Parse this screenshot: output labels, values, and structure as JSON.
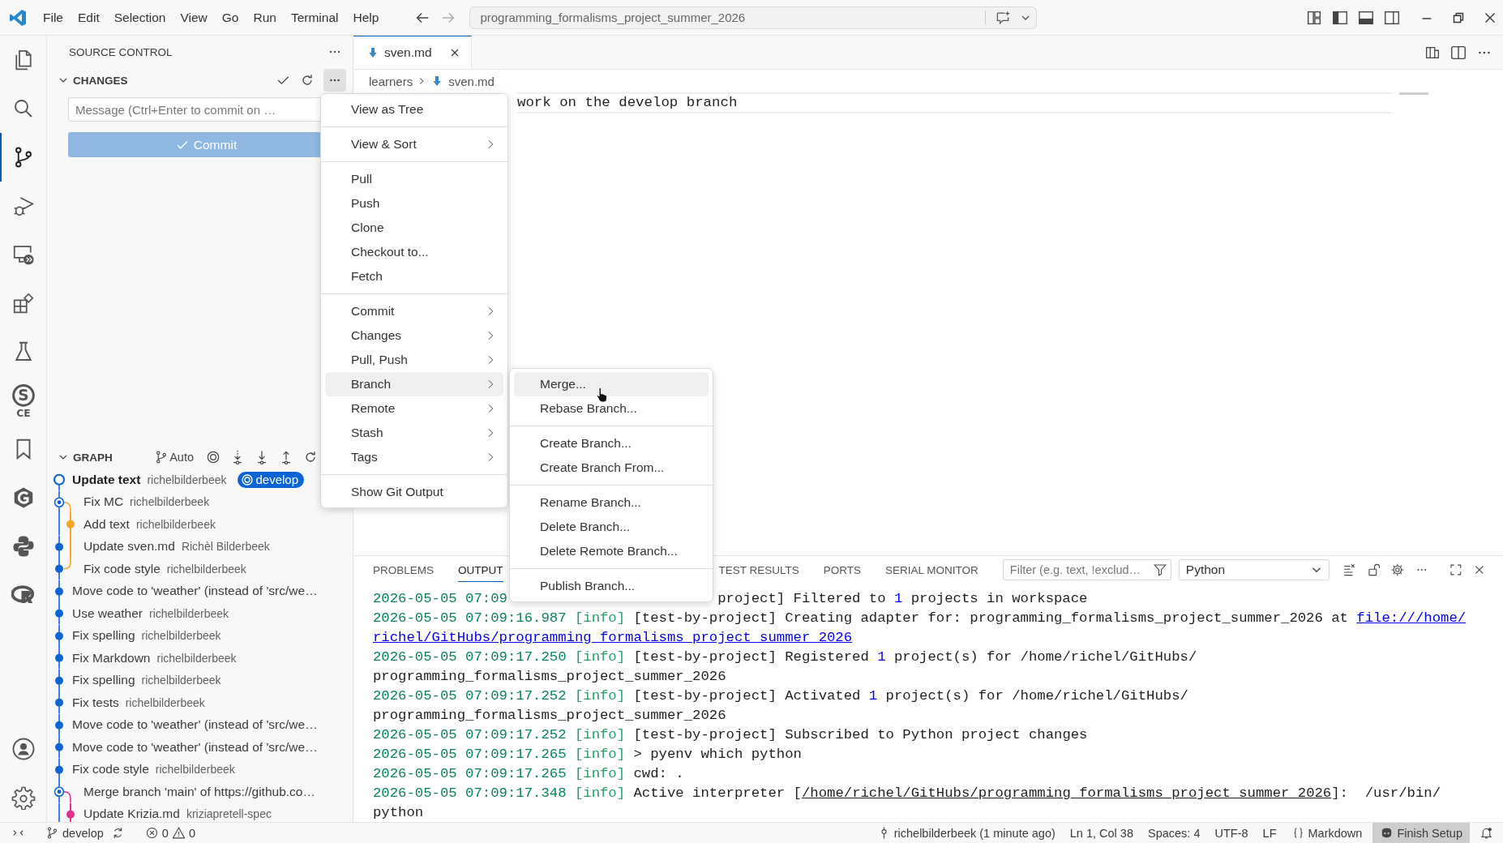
{
  "title_bar": {
    "menu": [
      "File",
      "Edit",
      "Selection",
      "View",
      "Go",
      "Run",
      "Terminal",
      "Help"
    ],
    "command_center": "programming_formalisms_project_summer_2026"
  },
  "activity_bar": [
    {
      "kind": "files",
      "selected": false
    },
    {
      "kind": "search",
      "selected": false
    },
    {
      "kind": "source-control",
      "selected": true
    },
    {
      "kind": "run-debug",
      "selected": false
    },
    {
      "kind": "remote",
      "selected": false
    },
    {
      "kind": "extensions",
      "selected": false
    },
    {
      "kind": "testing",
      "selected": false
    },
    {
      "kind": "letters",
      "letters": [
        "S",
        "CE"
      ],
      "selected": false
    },
    {
      "kind": "bookmark",
      "selected": false
    },
    {
      "kind": "hexagon",
      "selected": false
    },
    {
      "kind": "snakes",
      "selected": false
    },
    {
      "kind": "ring",
      "selected": false
    }
  ],
  "activity_bar_bottom": [
    {
      "kind": "account"
    },
    {
      "kind": "settings"
    }
  ],
  "sidebar": {
    "title": "SOURCE CONTROL",
    "changes": {
      "title": "CHANGES",
      "message": {
        "placeholder": "Message (Ctrl+Enter to commit on …"
      },
      "commit_button": {
        "label": "Commit",
        "disabled": true
      }
    },
    "graph": {
      "title": "GRAPH",
      "mode": "Auto",
      "commits": [
        {
          "message": "Update text",
          "author": "richelbilderbeek",
          "kind": "head",
          "color": "#0a64d6",
          "ref": "develop"
        },
        {
          "message": "Fix MC",
          "author": "richelbilderbeek",
          "kind": "merge",
          "color": "#0a64d6",
          "side_lane": {
            "kind": "start",
            "color": "#f5a623"
          }
        },
        {
          "message": "Add text",
          "author": "richelbilderbeek",
          "kind": "side",
          "color": "#f5a623",
          "side_lane": {
            "kind": "node",
            "color": "#f5a623"
          }
        },
        {
          "message": "Update sven.md",
          "author": "Richèl Bilderbeek",
          "kind": "commit",
          "color": "#0a64d6",
          "side_lane": {
            "kind": "through",
            "color": "#f5a623"
          }
        },
        {
          "message": "Fix code style",
          "author": "richelbilderbeek",
          "kind": "commit",
          "color": "#0a64d6",
          "side_lane": {
            "kind": "end",
            "color": "#f5a623"
          }
        },
        {
          "message": "Move code to 'weather' (instead of 'src/we…",
          "kind": "commit",
          "color": "#0a64d6"
        },
        {
          "message": "Use weather",
          "author": "richelbilderbeek",
          "kind": "commit",
          "color": "#0a64d6"
        },
        {
          "message": "Fix spelling",
          "author": "richelbilderbeek",
          "kind": "commit",
          "color": "#0a64d6"
        },
        {
          "message": "Fix Markdown",
          "author": "richelbilderbeek",
          "kind": "commit",
          "color": "#0a64d6"
        },
        {
          "message": "Fix spelling",
          "author": "richelbilderbeek",
          "kind": "commit",
          "color": "#0a64d6"
        },
        {
          "message": "Fix tests",
          "author": "richelbilderbeek",
          "kind": "commit",
          "color": "#0a64d6"
        },
        {
          "message": "Move code to 'weather' (instead of 'src/we…",
          "kind": "commit",
          "color": "#0a64d6"
        },
        {
          "message": "Move code to 'weather' (instead of 'src/we…",
          "kind": "commit",
          "color": "#0a64d6"
        },
        {
          "message": "Fix code style",
          "author": "richelbilderbeek",
          "kind": "commit",
          "color": "#0a64d6"
        },
        {
          "message": "Merge branch 'main' of https://github.co…",
          "kind": "merge",
          "color": "#0a64d6",
          "side_lane": {
            "kind": "start",
            "color": "#e0338a"
          }
        },
        {
          "message": "Update Krizia.md",
          "author": "kriziapretell-spec",
          "kind": "side",
          "color": "#e0338a",
          "side_lane": {
            "kind": "node",
            "color": "#e0338a"
          }
        }
      ]
    }
  },
  "editor": {
    "tabs": [
      {
        "label": "sven.md",
        "selected": true
      }
    ],
    "breadcrumb": [
      "learners",
      "sven.md"
    ],
    "lines": [
      "work on the develop branch"
    ]
  },
  "panel": {
    "tabs": [
      {
        "label": "PROBLEMS",
        "selected": false
      },
      {
        "label": "OUTPUT",
        "selected": true
      }
    ],
    "tabs_after_menu": [
      {
        "label": "TEST RESULTS",
        "selected": false
      },
      {
        "label": "PORTS",
        "selected": false
      },
      {
        "label": "SERIAL MONITOR",
        "selected": false
      }
    ],
    "filter": {
      "placeholder": "Filter (e.g. text, !exclud…"
    },
    "channel": "Python",
    "output": [
      {
        "segments": [
          {
            "kind": "time",
            "text": "2026-05-05 07:09"
          }
        ],
        "after_menu": [
          {
            "kind": "text",
            "text": "project] Filtered to "
          },
          {
            "kind": "number",
            "text": "1"
          },
          {
            "kind": "text",
            "text": " projects in workspace"
          }
        ]
      },
      {
        "segments": [
          {
            "kind": "time",
            "text": "2026-05-05 07:09:16.987"
          },
          {
            "kind": "level",
            "text": "[info]"
          },
          {
            "kind": "text",
            "text": "[test-by-project] Creating adapter for: programming_formalisms_project_summer_2026 at "
          },
          {
            "kind": "link",
            "text": "file:///home/"
          }
        ]
      },
      {
        "segments": [
          {
            "kind": "link",
            "text": "richel/GitHubs/programming_formalisms_project_summer_2026"
          }
        ]
      },
      {
        "segments": [
          {
            "kind": "time",
            "text": "2026-05-05 07:09:17.250"
          },
          {
            "kind": "level",
            "text": "[info]"
          },
          {
            "kind": "text",
            "text": "[test-by-project] Registered "
          },
          {
            "kind": "number",
            "text": "1"
          },
          {
            "kind": "text",
            "text": " project(s) for /home/richel/GitHubs/"
          }
        ]
      },
      {
        "segments": [
          {
            "kind": "text",
            "text": "programming_formalisms_project_summer_2026"
          }
        ]
      },
      {
        "segments": [
          {
            "kind": "time",
            "text": "2026-05-05 07:09:17.252"
          },
          {
            "kind": "level",
            "text": "[info]"
          },
          {
            "kind": "text",
            "text": "[test-by-project] Activated "
          },
          {
            "kind": "number",
            "text": "1"
          },
          {
            "kind": "text",
            "text": " project(s) for /home/richel/GitHubs/"
          }
        ]
      },
      {
        "segments": [
          {
            "kind": "text",
            "text": "programming_formalisms_project_summer_2026"
          }
        ]
      },
      {
        "segments": [
          {
            "kind": "time",
            "text": "2026-05-05 07:09:17.252"
          },
          {
            "kind": "level",
            "text": "[info]"
          },
          {
            "kind": "text",
            "text": "[test-by-project] Subscribed to Python project changes"
          }
        ]
      },
      {
        "segments": [
          {
            "kind": "time",
            "text": "2026-05-05 07:09:17.265"
          },
          {
            "kind": "level",
            "text": "[info]"
          },
          {
            "kind": "text",
            "text": "> pyenv which python"
          }
        ]
      },
      {
        "segments": [
          {
            "kind": "time",
            "text": "2026-05-05 07:09:17.265"
          },
          {
            "kind": "level",
            "text": "[info]"
          },
          {
            "kind": "text",
            "text": "cwd: ."
          }
        ]
      },
      {
        "segments": [
          {
            "kind": "time",
            "text": "2026-05-05 07:09:17.348"
          },
          {
            "kind": "level",
            "text": "[info]"
          },
          {
            "kind": "text",
            "text": "Active interpreter ["
          },
          {
            "kind": "path",
            "text": "/home/richel/GitHubs/programming_formalisms_project_summer_2026"
          },
          {
            "kind": "text",
            "text": "]:  /usr/bin/"
          }
        ]
      },
      {
        "segments": [
          {
            "kind": "text",
            "text": "python"
          }
        ]
      }
    ]
  },
  "menu": {
    "groups": [
      [
        {
          "label": "View as Tree",
          "submenu": false,
          "selected": false
        }
      ],
      [
        {
          "label": "View & Sort",
          "submenu": true,
          "selected": false
        }
      ],
      [
        {
          "label": "Pull",
          "submenu": false,
          "selected": false
        },
        {
          "label": "Push",
          "submenu": false,
          "selected": false
        },
        {
          "label": "Clone",
          "submenu": false,
          "selected": false
        },
        {
          "label": "Checkout to...",
          "submenu": false,
          "selected": false
        },
        {
          "label": "Fetch",
          "submenu": false,
          "selected": false
        }
      ],
      [
        {
          "label": "Commit",
          "submenu": true,
          "selected": false
        },
        {
          "label": "Changes",
          "submenu": true,
          "selected": false
        },
        {
          "label": "Pull, Push",
          "submenu": true,
          "selected": false
        },
        {
          "label": "Branch",
          "submenu": true,
          "selected": true
        },
        {
          "label": "Remote",
          "submenu": true,
          "selected": false
        },
        {
          "label": "Stash",
          "submenu": true,
          "selected": false
        },
        {
          "label": "Tags",
          "submenu": true,
          "selected": false
        }
      ],
      [
        {
          "label": "Show Git Output",
          "submenu": false,
          "selected": false
        }
      ]
    ]
  },
  "submenu": {
    "groups": [
      [
        {
          "label": "Merge...",
          "selected": true
        },
        {
          "label": "Rebase Branch...",
          "selected": false
        }
      ],
      [
        {
          "label": "Create Branch...",
          "selected": false
        },
        {
          "label": "Create Branch From...",
          "selected": false
        }
      ],
      [
        {
          "label": "Rename Branch...",
          "selected": false
        },
        {
          "label": "Delete Branch...",
          "selected": false
        },
        {
          "label": "Delete Remote Branch...",
          "selected": false
        }
      ],
      [
        {
          "label": "Publish Branch...",
          "selected": false
        }
      ]
    ]
  },
  "status_bar": {
    "left": [
      {
        "kind": "remote"
      },
      {
        "kind": "branch",
        "text": "develop"
      },
      {
        "kind": "sync"
      },
      {
        "kind": "problems",
        "errors": "0",
        "warnings": "0"
      }
    ],
    "right": [
      {
        "kind": "commit",
        "text": "richelbilderbeek (1 minute ago)"
      },
      {
        "kind": "plain",
        "text": "Ln 1, Col 38"
      },
      {
        "kind": "plain",
        "text": "Spaces: 4"
      },
      {
        "kind": "plain",
        "text": "UTF-8"
      },
      {
        "kind": "plain",
        "text": "LF"
      },
      {
        "kind": "language",
        "text": "Markdown"
      },
      {
        "kind": "setup",
        "text": "Finish Setup"
      },
      {
        "kind": "bell"
      }
    ]
  }
}
